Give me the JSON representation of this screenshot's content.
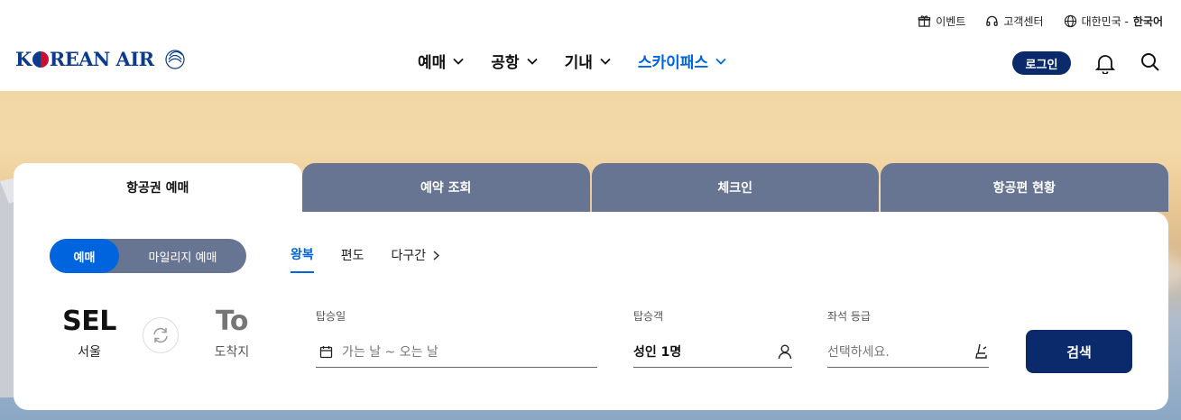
{
  "util_links": {
    "event": "이벤트",
    "support": "고객센터",
    "lang_country": "대한민국 - ",
    "lang_current": "한국어"
  },
  "brand": {
    "logo_part1": "K",
    "logo_part2": "REAN AIR",
    "alliance_icon": "skyteam-icon",
    "color_primary": "#0a2a6b",
    "color_accent": "#0064de"
  },
  "gnb": {
    "items": [
      {
        "label": "예매",
        "active": false
      },
      {
        "label": "공항",
        "active": false
      },
      {
        "label": "기내",
        "active": false
      },
      {
        "label": "스카이패스",
        "active": true
      }
    ]
  },
  "header_actions": {
    "login": "로그인",
    "notification_icon": "bell-icon",
    "search_icon": "search-icon"
  },
  "tabs": [
    {
      "label": "항공권 예매",
      "selected": true
    },
    {
      "label": "예약 조회",
      "selected": false
    },
    {
      "label": "체크인",
      "selected": false
    },
    {
      "label": "항공편 현황",
      "selected": false
    }
  ],
  "booking": {
    "mode_toggle": {
      "on": "예매",
      "off": "마일리지 예매"
    },
    "trip_types": [
      {
        "label": "왕복",
        "selected": true
      },
      {
        "label": "편도",
        "selected": false
      },
      {
        "label": "다구간",
        "selected": false
      }
    ],
    "from": {
      "code": "SEL",
      "name": "서울"
    },
    "to": {
      "code": "To",
      "name": "도착지"
    },
    "date": {
      "label": "탑승일",
      "placeholder": "가는 날 ~ 오는 날"
    },
    "passengers": {
      "label": "탑승객",
      "value": "성인 1명"
    },
    "cabin": {
      "label": "좌석 등급",
      "placeholder": "선택하세요."
    },
    "search_button": "검색"
  }
}
